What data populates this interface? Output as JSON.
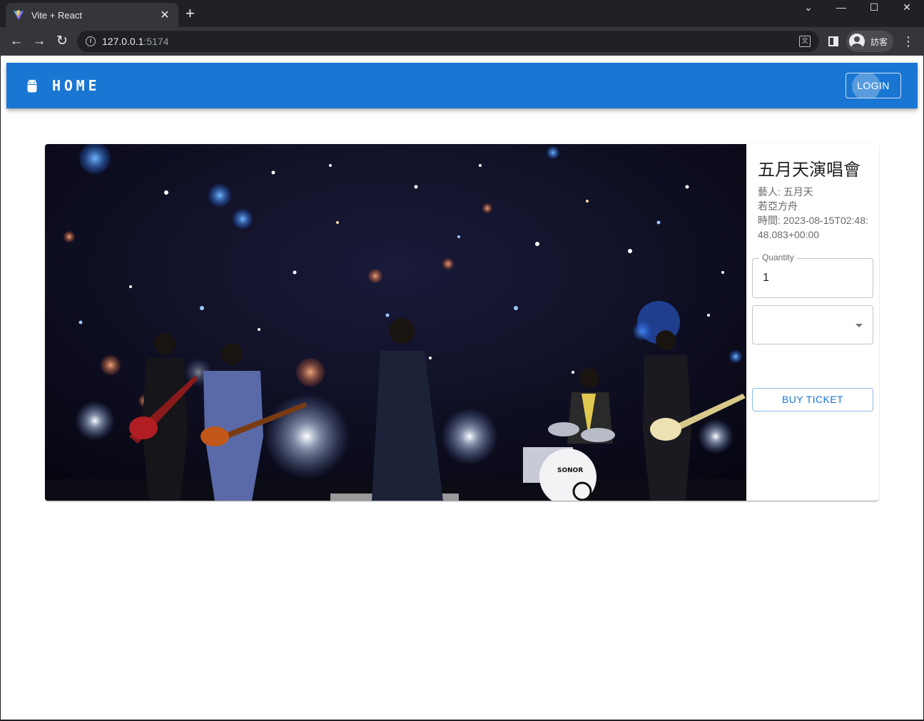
{
  "browser": {
    "tab_title": "Vite + React",
    "tab_close": "✕",
    "new_tab": "+",
    "url_host": "127.0.0.1",
    "url_port": ":5174",
    "profile_label": "訪客",
    "window_controls": {
      "minimize": "—",
      "maximize": "☐",
      "close": "✕",
      "tab_search": "⌄"
    },
    "nav": {
      "back": "←",
      "forward": "→",
      "reload": "↻"
    },
    "menu": "⋮"
  },
  "appbar": {
    "brand": "HOME",
    "login_label": "LOGIN",
    "color": "#1976d2"
  },
  "event": {
    "title": "五月天演唱會",
    "artist_line": "藝人: 五月天",
    "venue_line": "若亞方舟",
    "time_line": "時間: 2023-08-15T02:48:48.083+00:00",
    "quantity_label": "Quantity",
    "quantity_value": "1",
    "select_value": "",
    "buy_label": "BUY TICKET"
  }
}
